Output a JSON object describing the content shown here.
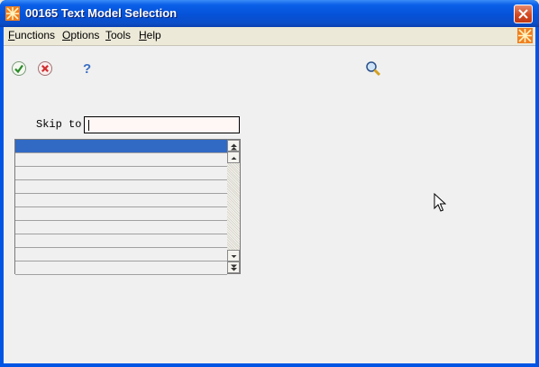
{
  "window": {
    "title": "00165 Text Model Selection",
    "close_icon": "close-icon",
    "app_icon": "jde-logo-icon"
  },
  "menubar": {
    "items": [
      {
        "label": "Functions",
        "underline": "F"
      },
      {
        "label": "Options",
        "underline": "O"
      },
      {
        "label": "Tools",
        "underline": "T"
      },
      {
        "label": "Help",
        "underline": "H"
      }
    ],
    "logo_icon": "jde-logo-icon"
  },
  "toolbar": {
    "buttons": [
      {
        "name": "ok",
        "icon": "checkmark-icon",
        "color": "#2a8a2a"
      },
      {
        "name": "cancel",
        "icon": "x-circle-icon",
        "color": "#d03030"
      },
      {
        "name": "help",
        "icon": "question-mark-icon",
        "color": "#3a6fc4"
      },
      {
        "name": "find",
        "icon": "magnifier-icon",
        "color": "#d4a020"
      }
    ]
  },
  "skip_to": {
    "label": "Skip to",
    "value": ""
  },
  "grid": {
    "rows": [
      "",
      "",
      "",
      "",
      "",
      "",
      "",
      "",
      "",
      ""
    ],
    "selected_row": 0,
    "selected_color": "#316ac5"
  },
  "colors": {
    "titlebar": "#0552d8",
    "client": "#f0f0f0",
    "input_bg": "#fff6f6"
  }
}
